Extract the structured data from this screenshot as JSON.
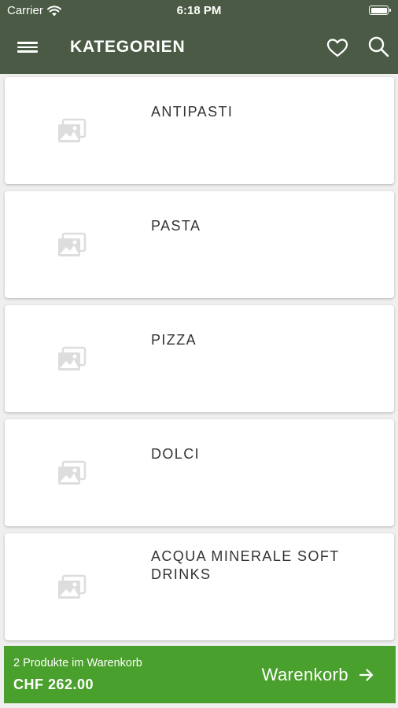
{
  "status_bar": {
    "carrier": "Carrier",
    "time": "6:18 PM"
  },
  "app_bar": {
    "title": "KATEGORIEN"
  },
  "categories": [
    {
      "label": "ANTIPASTI",
      "icon": "image-placeholder-icon"
    },
    {
      "label": "PASTA",
      "icon": "image-placeholder-icon"
    },
    {
      "label": "PIZZA",
      "icon": "image-placeholder-icon"
    },
    {
      "label": "DOLCI",
      "icon": "image-placeholder-icon"
    },
    {
      "label": "ACQUA MINERALE SOFT DRINKS",
      "icon": "image-placeholder-icon"
    }
  ],
  "cart": {
    "count_text": "2 Produkte im Warenkorb",
    "total": "CHF 262.00",
    "button_label": "Warenkorb"
  },
  "colors": {
    "header": "#4a5a44",
    "cart_bar": "#4aa02c",
    "background": "#efefef"
  }
}
